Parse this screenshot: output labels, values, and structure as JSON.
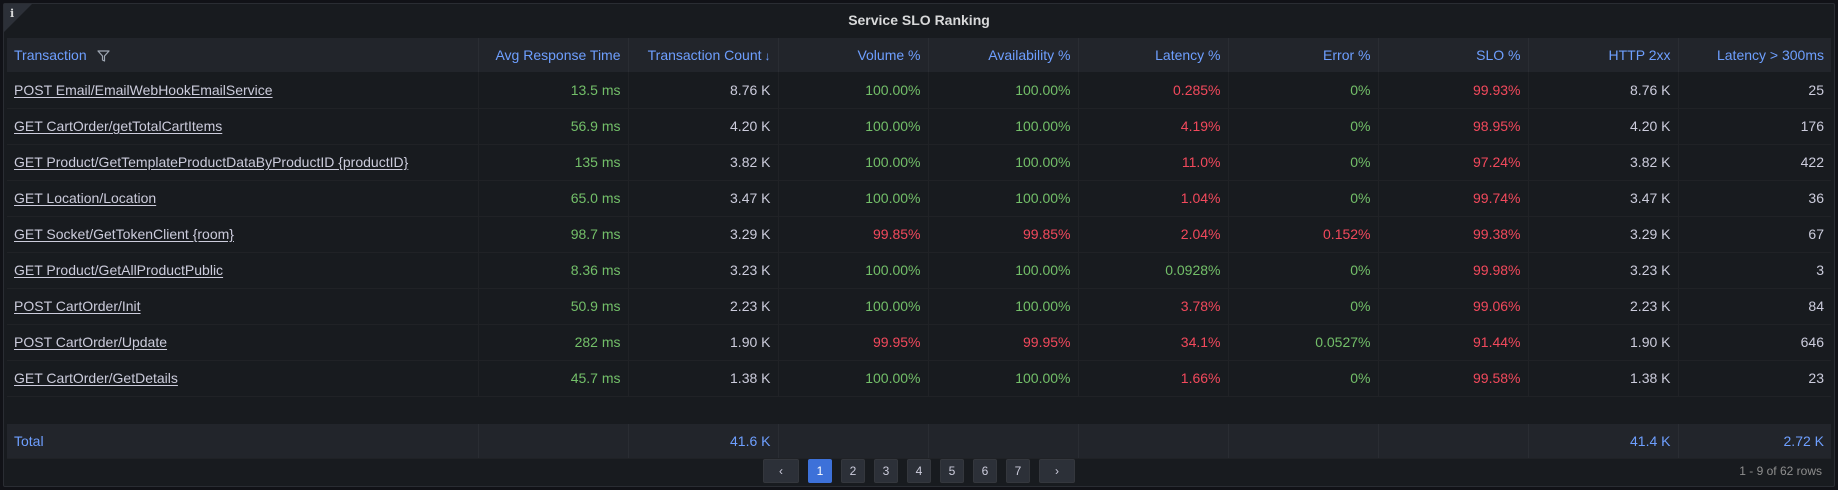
{
  "panel": {
    "title": "Service SLO Ranking",
    "info_icon": "i"
  },
  "columns": [
    "Transaction",
    "Avg Response Time",
    "Transaction Count",
    "Volume %",
    "Availability %",
    "Latency %",
    "Error %",
    "SLO %",
    "HTTP 2xx",
    "Latency > 300ms"
  ],
  "sort_indicator": "↓",
  "rows": [
    [
      "POST Email/EmailWebHookEmailService",
      "13.5 ms",
      "8.76 K",
      "100.00%",
      "100.00%",
      "0.285%",
      "0%",
      "99.93%",
      "8.76 K",
      "25"
    ],
    [
      "GET CartOrder/getTotalCartItems",
      "56.9 ms",
      "4.20 K",
      "100.00%",
      "100.00%",
      "4.19%",
      "0%",
      "98.95%",
      "4.20 K",
      "176"
    ],
    [
      "GET Product/GetTemplateProductDataByProductID {productID}",
      "135 ms",
      "3.82 K",
      "100.00%",
      "100.00%",
      "11.0%",
      "0%",
      "97.24%",
      "3.82 K",
      "422"
    ],
    [
      "GET Location/Location",
      "65.0 ms",
      "3.47 K",
      "100.00%",
      "100.00%",
      "1.04%",
      "0%",
      "99.74%",
      "3.47 K",
      "36"
    ],
    [
      "GET Socket/GetTokenClient {room}",
      "98.7 ms",
      "3.29 K",
      "99.85%",
      "99.85%",
      "2.04%",
      "0.152%",
      "99.38%",
      "3.29 K",
      "67"
    ],
    [
      "GET Product/GetAllProductPublic",
      "8.36 ms",
      "3.23 K",
      "100.00%",
      "100.00%",
      "0.0928%",
      "0%",
      "99.98%",
      "3.23 K",
      "3"
    ],
    [
      "POST CartOrder/Init",
      "50.9 ms",
      "2.23 K",
      "100.00%",
      "100.00%",
      "3.78%",
      "0%",
      "99.06%",
      "2.23 K",
      "84"
    ],
    [
      "POST CartOrder/Update",
      "282 ms",
      "1.90 K",
      "99.95%",
      "99.95%",
      "34.1%",
      "0.0527%",
      "91.44%",
      "1.90 K",
      "646"
    ],
    [
      "GET CartOrder/GetDetails",
      "45.7 ms",
      "1.38 K",
      "100.00%",
      "100.00%",
      "1.66%",
      "0%",
      "99.58%",
      "1.38 K",
      "23"
    ]
  ],
  "row_colors": [
    [
      "white",
      "green",
      "white",
      "green",
      "green",
      "red",
      "green",
      "red",
      "white",
      "white"
    ],
    [
      "white",
      "green",
      "white",
      "green",
      "green",
      "red",
      "green",
      "red",
      "white",
      "white"
    ],
    [
      "white",
      "green",
      "white",
      "green",
      "green",
      "red",
      "green",
      "red",
      "white",
      "white"
    ],
    [
      "white",
      "green",
      "white",
      "green",
      "green",
      "red",
      "green",
      "red",
      "white",
      "white"
    ],
    [
      "white",
      "green",
      "white",
      "red",
      "red",
      "red",
      "red",
      "red",
      "white",
      "white"
    ],
    [
      "white",
      "green",
      "white",
      "green",
      "green",
      "green",
      "green",
      "red",
      "white",
      "white"
    ],
    [
      "white",
      "green",
      "white",
      "green",
      "green",
      "red",
      "green",
      "red",
      "white",
      "white"
    ],
    [
      "white",
      "green",
      "white",
      "red",
      "red",
      "red",
      "green",
      "red",
      "white",
      "white"
    ],
    [
      "white",
      "green",
      "white",
      "green",
      "green",
      "red",
      "green",
      "red",
      "white",
      "white"
    ]
  ],
  "total": [
    "Total",
    "",
    "41.6 K",
    "",
    "",
    "",
    "",
    "",
    "41.4 K",
    "2.72 K"
  ],
  "pagination": {
    "prev": "‹",
    "next": "›",
    "pages": [
      "1",
      "2",
      "3",
      "4",
      "5",
      "6",
      "7"
    ],
    "current": "1",
    "rows_info": "1 - 9 of 62 rows"
  },
  "colors": {
    "accent": "#6e9fff",
    "green": "#73bf69",
    "red": "#f2495c",
    "active_page": "#3d71d9"
  }
}
